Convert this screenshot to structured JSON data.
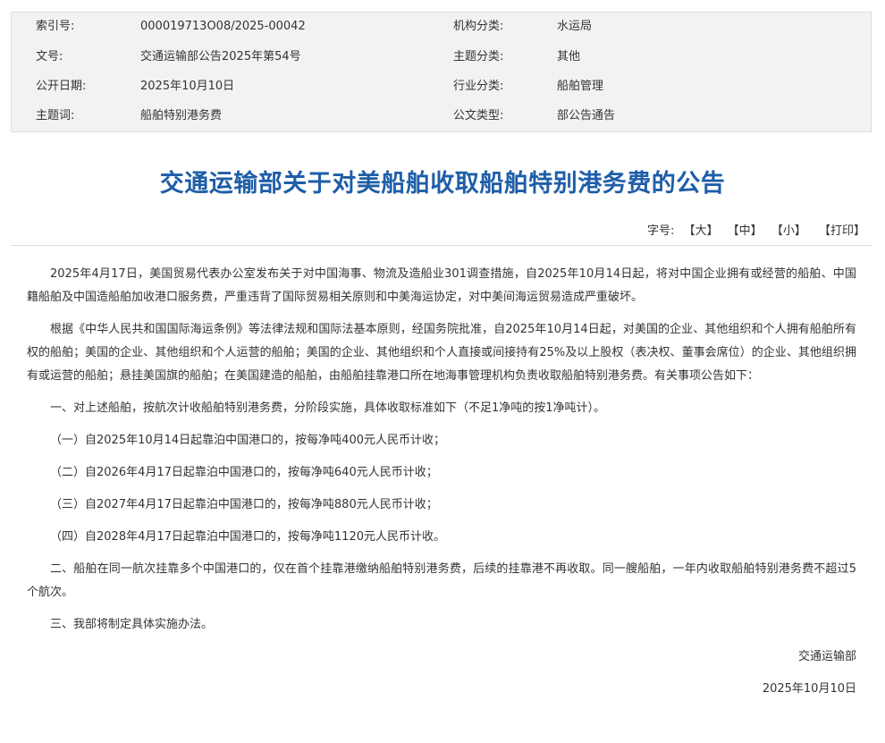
{
  "meta": {
    "rows": [
      {
        "k1": "索引号:",
        "v1": "000019713O08/2025-00042",
        "k2": "机构分类:",
        "v2": "水运局"
      },
      {
        "k1": "文号:",
        "v1": "交通运输部公告2025年第54号",
        "k2": "主题分类:",
        "v2": "其他"
      },
      {
        "k1": "公开日期:",
        "v1": "2025年10月10日",
        "k2": "行业分类:",
        "v2": "船舶管理"
      },
      {
        "k1": "主题词:",
        "v1": "船舶特别港务费",
        "k2": "公文类型:",
        "v2": "部公告通告"
      }
    ]
  },
  "title": "交通运输部关于对美船舶收取船舶特别港务费的公告",
  "fontsize": {
    "label": "字号:",
    "large": "【大】",
    "medium": "【中】",
    "small": "【小】",
    "print": "【打印】"
  },
  "body": {
    "paragraphs": [
      "2025年4月17日，美国贸易代表办公室发布关于对中国海事、物流及造船业301调查措施，自2025年10月14日起，将对中国企业拥有或经营的船舶、中国籍船舶及中国造船舶加收港口服务费，严重违背了国际贸易相关原则和中美海运协定，对中美间海运贸易造成严重破坏。",
      "根据《中华人民共和国国际海运条例》等法律法规和国际法基本原则，经国务院批准，自2025年10月14日起，对美国的企业、其他组织和个人拥有船舶所有权的船舶；美国的企业、其他组织和个人运营的船舶；美国的企业、其他组织和个人直接或间接持有25%及以上股权（表决权、董事会席位）的企业、其他组织拥有或运营的船舶；悬挂美国旗的船舶；在美国建造的船舶，由船舶挂靠港口所在地海事管理机构负责收取船舶特别港务费。有关事项公告如下：",
      "一、对上述船舶，按航次计收船舶特别港务费，分阶段实施，具体收取标准如下（不足1净吨的按1净吨计）。",
      "（一）自2025年10月14日起靠泊中国港口的，按每净吨400元人民币计收；",
      "（二）自2026年4月17日起靠泊中国港口的，按每净吨640元人民币计收；",
      "（三）自2027年4月17日起靠泊中国港口的，按每净吨880元人民币计收；",
      "（四）自2028年4月17日起靠泊中国港口的，按每净吨1120元人民币计收。",
      "二、船舶在同一航次挂靠多个中国港口的，仅在首个挂靠港缴纳船舶特别港务费，后续的挂靠港不再收取。同一艘船舶，一年内收取船舶特别港务费不超过5个航次。",
      "三、我部将制定具体实施办法。"
    ],
    "signature_org": "交通运输部",
    "signature_date": "2025年10月10日"
  }
}
